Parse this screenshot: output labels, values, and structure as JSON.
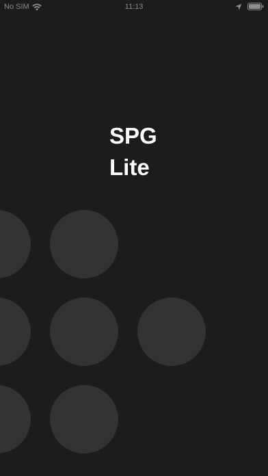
{
  "status_bar": {
    "carrier": "No SIM",
    "time": "11:13",
    "icons": [
      "wifi-icon",
      "location-icon",
      "battery-icon"
    ]
  },
  "title": {
    "line1": "SPG",
    "line2": "Lite"
  },
  "colors": {
    "background": "#1c1c1c",
    "circle": "#333333",
    "text": "#ffffff",
    "status_text": "#8e8e8e"
  }
}
